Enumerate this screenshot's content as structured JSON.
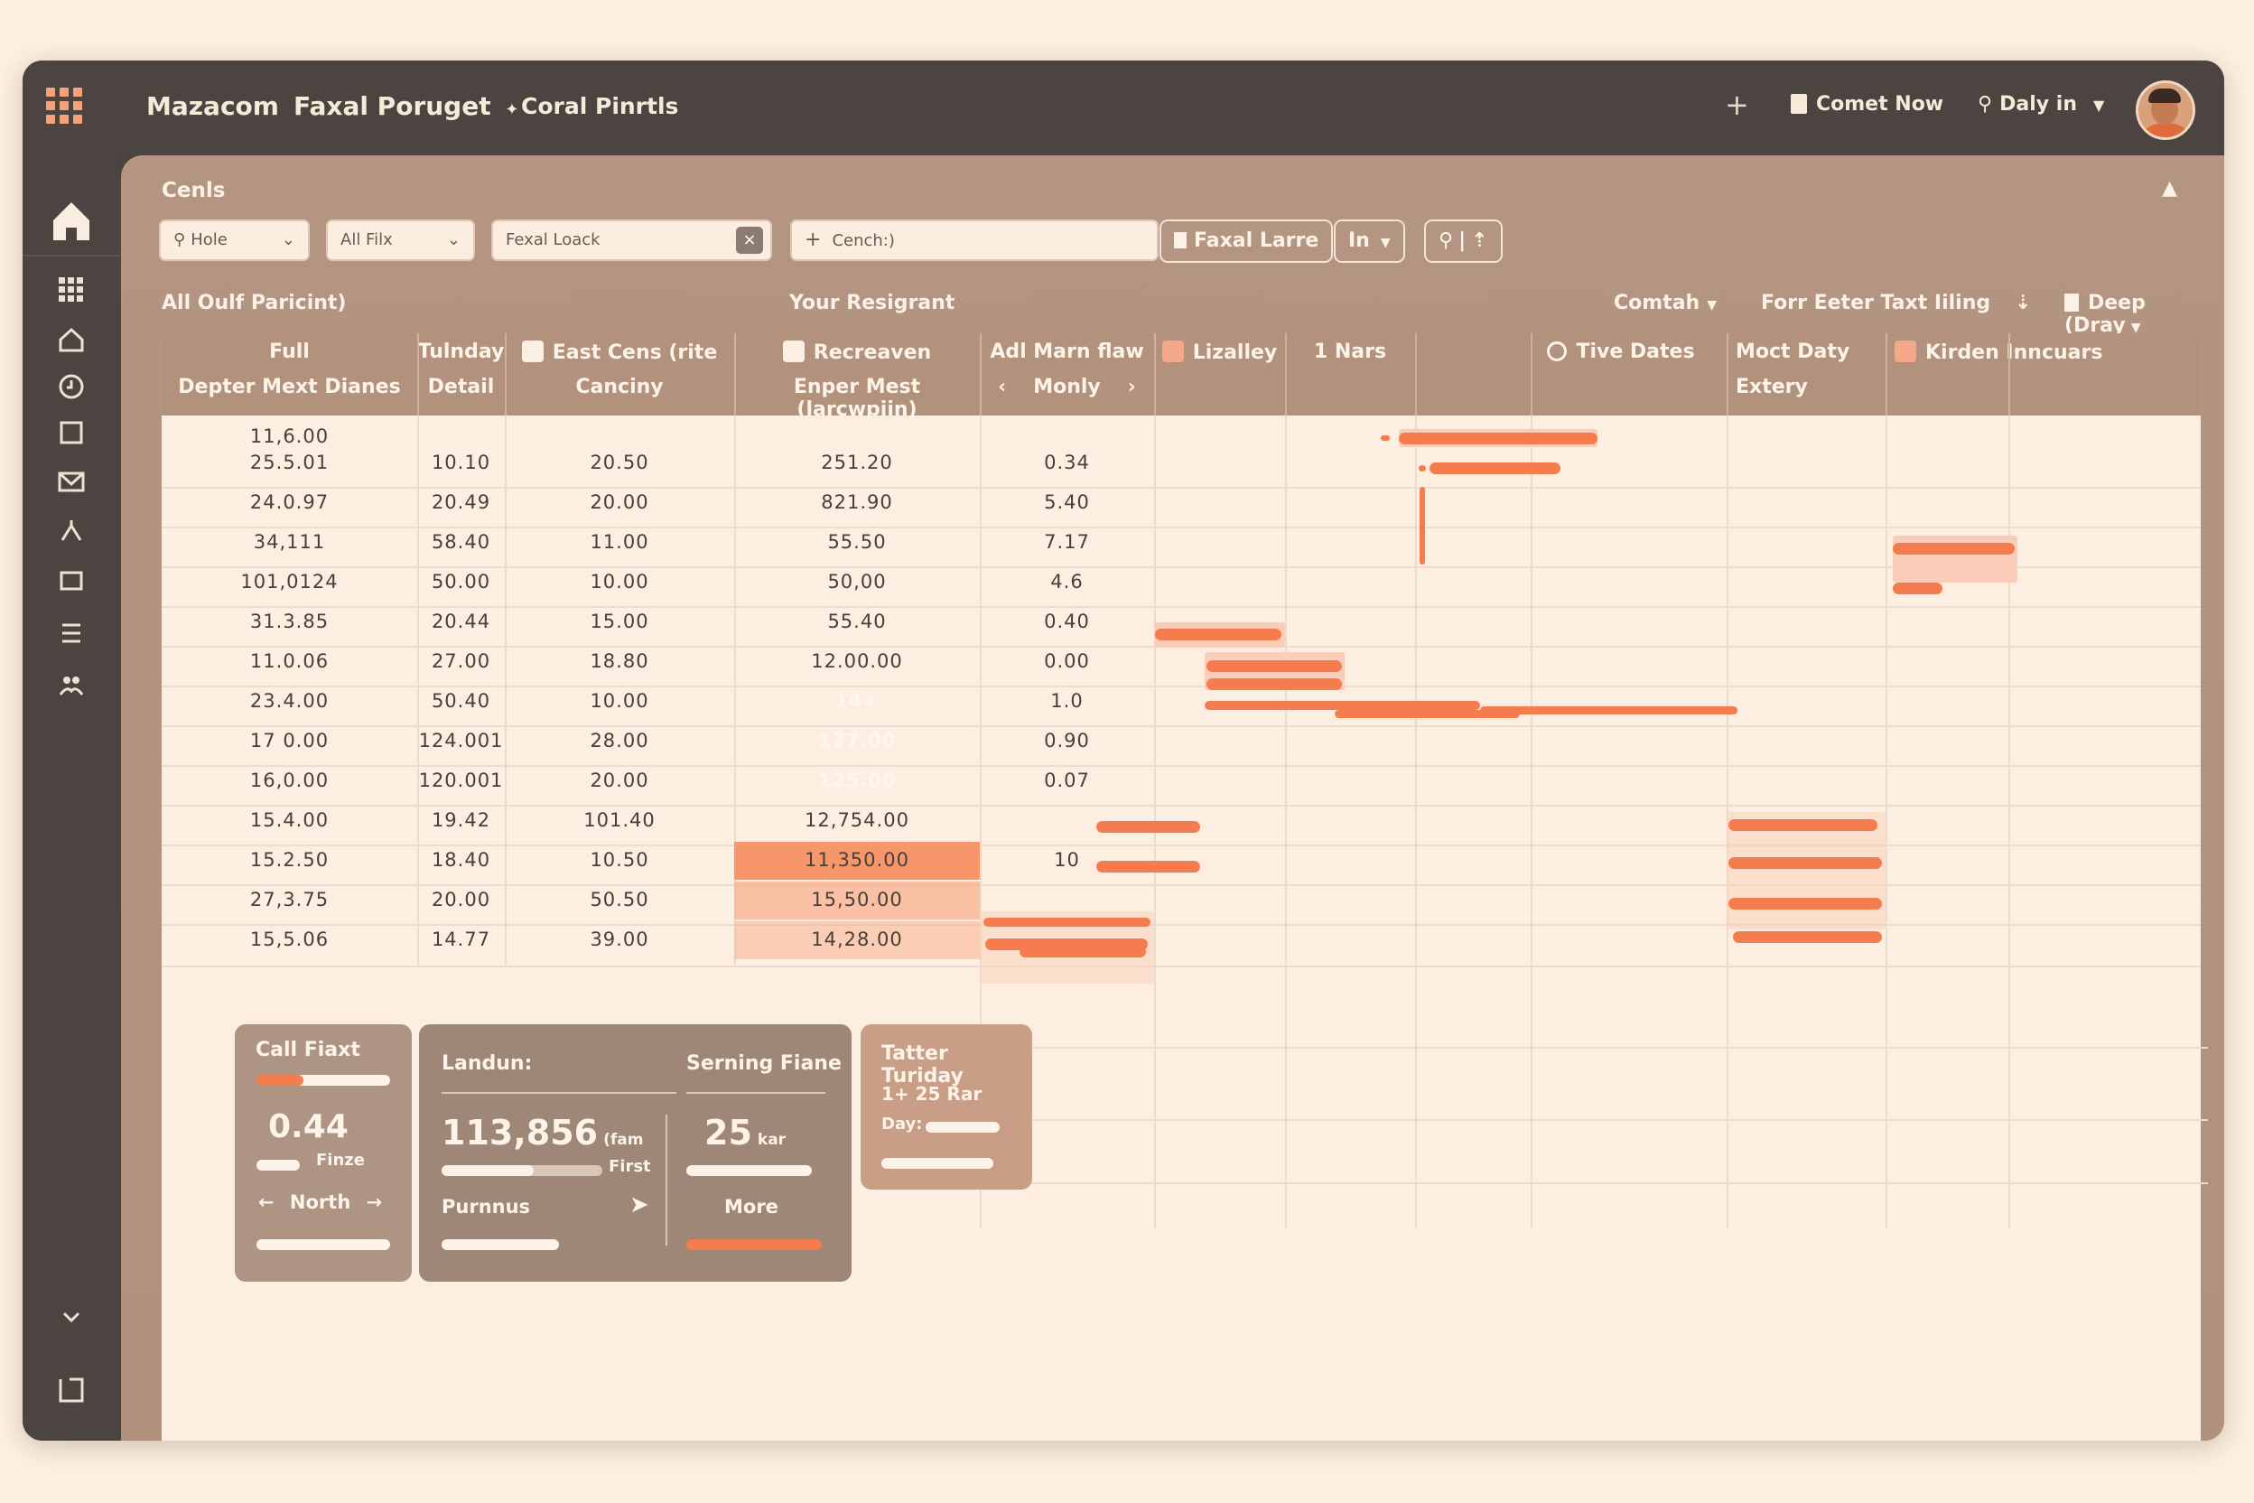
{
  "header": {
    "app_title": "Mazacom",
    "project": "Faxal Poruget",
    "project_suffix": "✦",
    "nav_link": "Coral Pinrtls",
    "plus_icon": "+",
    "comet_label": "Comet Now",
    "daily_label": "Daly in"
  },
  "sidebar": {
    "items": [
      "home-icon",
      "apps-grid-icon",
      "house-outline-icon",
      "clock-icon",
      "square-icon",
      "mail-icon",
      "branch-icon",
      "window-icon",
      "list-icon",
      "people-icon",
      "chevron-down-icon",
      "panel-icon"
    ]
  },
  "main": {
    "title": "Cenls",
    "filters": {
      "hole": "Hole",
      "all_filx": "All Filx",
      "fexal_loack": "Fexal Loack",
      "cench_placeholder": "Cench:)",
      "faxal_larre": "Faxal Larre",
      "in_label": "In"
    },
    "section_left": "All Oulf Paricint)",
    "section_mid": "Your Resigrant",
    "section_right1": "Comtah",
    "section_right2": "Forr Eeter Taxt Iiling",
    "section_right3": "Deep (Dray"
  },
  "table": {
    "headers": [
      {
        "l1": "Full",
        "l2": "Depter Mext Dianes"
      },
      {
        "l1": "Tulnday",
        "l2": "Detail"
      },
      {
        "l1": "East Cens (rite",
        "l2": "Canciny"
      },
      {
        "l1": "Recreaven",
        "l2": "Enper Mest (larcwpiin)"
      },
      {
        "l1": "Adl Marn flaw",
        "l2": "Monly"
      },
      {
        "l1": "Lizalley",
        "l2": ""
      },
      {
        "l1": "1 Nars",
        "l2": ""
      },
      {
        "l1": "Tive Dates",
        "l2": ""
      },
      {
        "l1": "Moct Daty",
        "l2": "Extery"
      },
      {
        "l1": "Kirden Inncuars",
        "l2": ""
      }
    ],
    "rows": [
      [
        "11,6.00",
        "",
        "",
        "",
        ""
      ],
      [
        "25.5.01",
        "10.10",
        "20.50",
        "251.20",
        "0.34"
      ],
      [
        "24.0.97",
        "20.49",
        "20.00",
        "821.90",
        "5.40"
      ],
      [
        "34,111",
        "58.40",
        "11.00",
        "55.50",
        "7.17"
      ],
      [
        "101,0124",
        "50.00",
        "10.00",
        "50,00",
        "4.6"
      ],
      [
        "31.3.85",
        "20.44",
        "15.00",
        "55.40",
        "0.40"
      ],
      [
        "11.0.06",
        "27.00",
        "18.80",
        "12.00.00",
        "0.00"
      ],
      [
        "23.4.00",
        "50.40",
        "10.00",
        "14+",
        "1.0"
      ],
      [
        "17 0.00",
        "124.001",
        "28.00",
        "137.00",
        "0.90"
      ],
      [
        "16,0.00",
        "120.001",
        "20.00",
        "125.00",
        "0.07"
      ],
      [
        "15.4.00",
        "19.42",
        "101.40",
        "12,754.00",
        ""
      ],
      [
        "15.2.50",
        "18.40",
        "10.50",
        "11,350.00",
        "10"
      ],
      [
        "27,3.75",
        "20.00",
        "50.50",
        "15,50.00",
        ""
      ],
      [
        "15,5.06",
        "14.77",
        "39.00",
        "14,28.00",
        ""
      ]
    ]
  },
  "cards": {
    "call": {
      "title": "Call Fiaxt",
      "value": "0.44",
      "sub": "Finze",
      "nav": "North"
    },
    "landun": {
      "title": "Landun:",
      "title2": "Serning Fiane",
      "value": "113,856",
      "unit": "(fam",
      "value2": "25",
      "unit2": "kar",
      "sub": "First",
      "link": "Purnnus",
      "more": "More"
    },
    "tater": {
      "title": "Tatter Turiday",
      "line1": "1+ 25 Rar",
      "line2": "Day:"
    }
  },
  "colors": {
    "accent": "#f47c4f",
    "panel": "#b39581",
    "bg": "#fcefe1",
    "dark": "#4b4441"
  }
}
